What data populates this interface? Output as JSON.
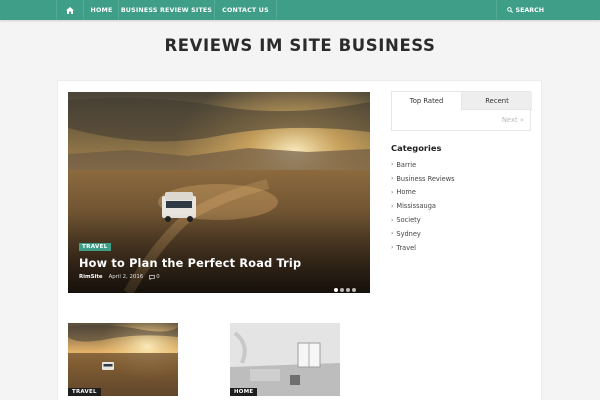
{
  "nav": {
    "home_icon": "home-icon",
    "items": [
      "HOME",
      "BUSINESS REVIEW SITES",
      "CONTACT US"
    ],
    "search_label": "SEARCH",
    "color": "#3e9e87"
  },
  "site": {
    "title": "REVIEWS IM SITE BUSINESS"
  },
  "hero": {
    "category": "TRAVEL",
    "title": "How to Plan the Perfect Road Trip",
    "author": "RimSite",
    "date": "April 2, 2016",
    "comments": "0",
    "slides": 4,
    "active_slide": 1
  },
  "sidebar": {
    "tabs": [
      "Top Rated",
      "Recent"
    ],
    "next_label": "Next »",
    "categories_title": "Categories",
    "categories": [
      "Barrie",
      "Business Reviews",
      "Home",
      "Mississauga",
      "Society",
      "Sydney",
      "Travel"
    ]
  },
  "thumbs": [
    {
      "category": "TRAVEL"
    },
    {
      "category": "HOME"
    }
  ]
}
